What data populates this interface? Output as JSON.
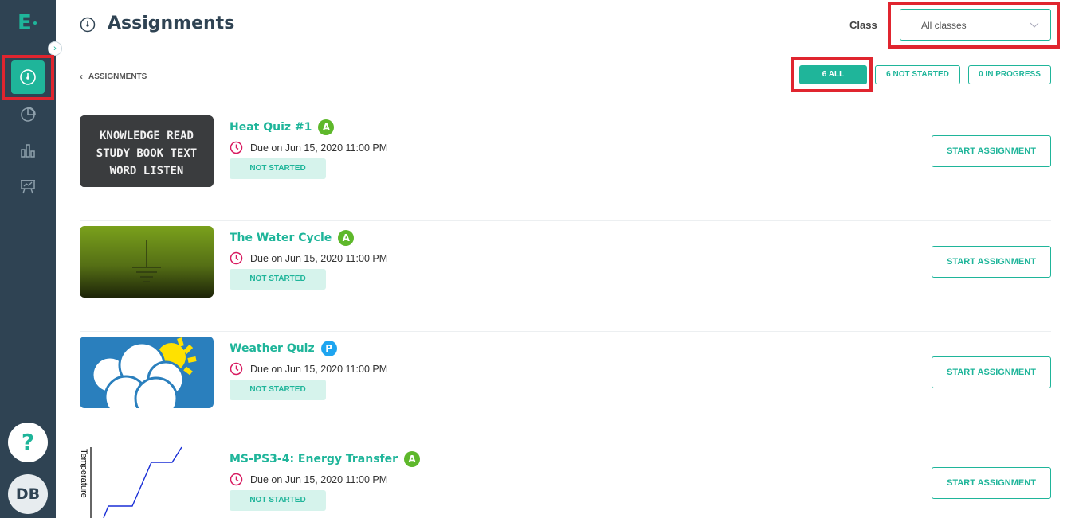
{
  "sidebar": {
    "logo": "E",
    "items": [
      {
        "icon": "dashboard-gauge-icon",
        "active": true
      },
      {
        "icon": "pie-chart-icon",
        "active": false
      },
      {
        "icon": "bar-chart-icon",
        "active": false
      },
      {
        "icon": "presentation-board-icon",
        "active": false
      }
    ],
    "help_label": "?",
    "avatar_initials": "DB"
  },
  "header": {
    "title": "Assignments",
    "class_label": "Class",
    "class_select_value": "All classes"
  },
  "breadcrumb": {
    "label": "ASSIGNMENTS"
  },
  "filters": [
    {
      "label": "6 ALL",
      "active": true
    },
    {
      "label": "6 NOT STARTED",
      "active": false
    },
    {
      "label": "0 IN PROGRESS",
      "active": false
    }
  ],
  "assignments": [
    {
      "title": "Heat Quiz #1",
      "badge": "A",
      "due": "Due on Jun 15, 2020 11:00 PM",
      "status": "NOT STARTED",
      "action": "START ASSIGNMENT",
      "thumb_text": [
        "KNOWLEDGE READ",
        "STUDY BOOK TEXT",
        "WORD LISTEN"
      ]
    },
    {
      "title": "The Water Cycle",
      "badge": "A",
      "due": "Due on Jun 15, 2020 11:00 PM",
      "status": "NOT STARTED",
      "action": "START ASSIGNMENT"
    },
    {
      "title": "Weather Quiz",
      "badge": "P",
      "due": "Due on Jun 15, 2020 11:00 PM",
      "status": "NOT STARTED",
      "action": "START ASSIGNMENT"
    },
    {
      "title": "MS-PS3-4: Energy Transfer",
      "badge": "A",
      "due": "Due on Jun 15, 2020 11:00 PM",
      "status": "NOT STARTED",
      "action": "START ASSIGNMENT",
      "thumb_text": [
        "Temperature"
      ]
    }
  ],
  "colors": {
    "accent": "#1fb59a",
    "sidebar": "#2f4353",
    "highlight": "#e0252f",
    "due_icon": "#d81b60"
  }
}
